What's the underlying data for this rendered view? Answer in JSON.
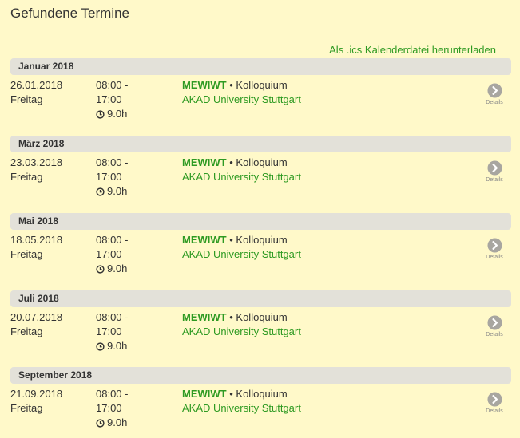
{
  "page": {
    "title": "Gefundene Termine",
    "ics_link": "Als .ics Kalenderdatei herunterladen"
  },
  "colors": {
    "background": "#fff9c9",
    "accent_green": "#2e9a22",
    "month_header_bg": "#e3e1d9",
    "details_icon": "#a8a6a0"
  },
  "icons": {
    "duration": "clock-icon",
    "details": "chevron-right-circle-icon"
  },
  "groups": [
    {
      "month": "Januar 2018",
      "event": {
        "date": "26.01.2018",
        "weekday": "Freitag",
        "time_start": "08:00 -",
        "time_end": "17:00",
        "duration": "9.0h",
        "code": "MEWIWT",
        "separator": "•",
        "type": "Kolloquium",
        "location": "AKAD University Stuttgart",
        "details_label": "Details"
      }
    },
    {
      "month": "März 2018",
      "event": {
        "date": "23.03.2018",
        "weekday": "Freitag",
        "time_start": "08:00 -",
        "time_end": "17:00",
        "duration": "9.0h",
        "code": "MEWIWT",
        "separator": "•",
        "type": "Kolloquium",
        "location": "AKAD University Stuttgart",
        "details_label": "Details"
      }
    },
    {
      "month": "Mai 2018",
      "event": {
        "date": "18.05.2018",
        "weekday": "Freitag",
        "time_start": "08:00 -",
        "time_end": "17:00",
        "duration": "9.0h",
        "code": "MEWIWT",
        "separator": "•",
        "type": "Kolloquium",
        "location": "AKAD University Stuttgart",
        "details_label": "Details"
      }
    },
    {
      "month": "Juli 2018",
      "event": {
        "date": "20.07.2018",
        "weekday": "Freitag",
        "time_start": "08:00 -",
        "time_end": "17:00",
        "duration": "9.0h",
        "code": "MEWIWT",
        "separator": "•",
        "type": "Kolloquium",
        "location": "AKAD University Stuttgart",
        "details_label": "Details"
      }
    },
    {
      "month": "September 2018",
      "event": {
        "date": "21.09.2018",
        "weekday": "Freitag",
        "time_start": "08:00 -",
        "time_end": "17:00",
        "duration": "9.0h",
        "code": "MEWIWT",
        "separator": "•",
        "type": "Kolloquium",
        "location": "AKAD University Stuttgart",
        "details_label": "Details"
      }
    }
  ]
}
